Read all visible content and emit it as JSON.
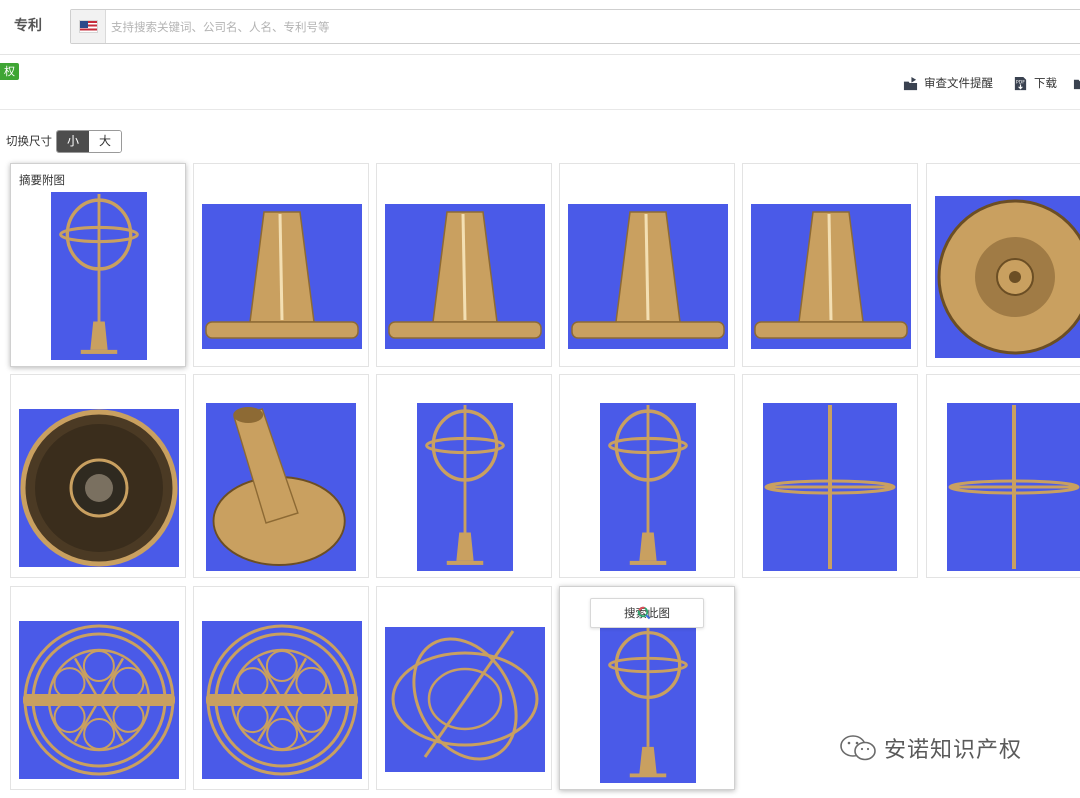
{
  "header": {
    "brand": "专利",
    "region_icon": "us-flag-icon",
    "search_placeholder": "支持搜索关键词、公司名、人名、专利号等"
  },
  "status_badge": "权",
  "actions": [
    {
      "label": "审查文件提醒",
      "icon": "review-reminder-icon"
    },
    {
      "label": "下载",
      "icon": "pdf-download-icon"
    }
  ],
  "size_switch": {
    "label": "切换尺寸",
    "options": [
      "小",
      "大"
    ],
    "selected": "小"
  },
  "gallery": {
    "abstract_caption": "摘要附图",
    "hover_search_label": "搜索此图",
    "background_color": "#4a5ae8",
    "metal_color": "#c9a060",
    "views": [
      "gyroscope-front",
      "stand-side",
      "stand-side",
      "stand-side",
      "stand-side",
      "base-top",
      "base-bottom",
      "stand-perspective",
      "gyroscope-front",
      "gyroscope-front",
      "gyroscope-edge",
      "gyroscope-edge",
      "gyroscope-top",
      "gyroscope-top",
      "gyroscope-perspective",
      "gyroscope-front"
    ]
  },
  "watermark": "安诺知识产权"
}
